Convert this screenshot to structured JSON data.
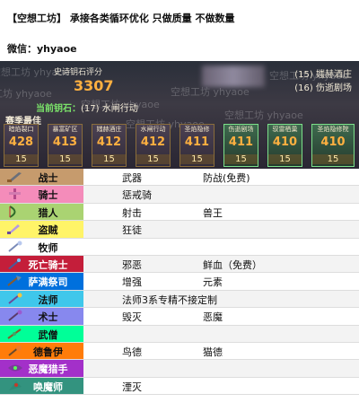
{
  "header": {
    "line1": "【空想工坊】  承接各类循环优化  只做质量  不做数量",
    "line2": "微信：yhyaoe"
  },
  "panel": {
    "score_label": "史诗钥石评分",
    "score_value": "3307",
    "side_items": [
      "(15) 媸赫酒庄",
      "(16) 伤逝剧场"
    ],
    "current_label": "当前钥石：",
    "current_value": "(17) 水闸行动",
    "season_label": "赛季最佳",
    "watermark": "空想工坊 yhyaoe",
    "dungeons": [
      {
        "name": "暗焰裂口",
        "score": "428",
        "level": "15"
      },
      {
        "name": "暴富矿区",
        "score": "413",
        "level": "15"
      },
      {
        "name": "媸赫酒庄",
        "score": "412",
        "level": "15"
      },
      {
        "name": "水闸行动",
        "score": "412",
        "level": "15"
      },
      {
        "name": "圣焰隐修",
        "score": "411",
        "level": "15"
      },
      {
        "name": "伤逝剧场",
        "score": "411",
        "level": "15"
      },
      {
        "name": "驭雷栖巢",
        "score": "410",
        "level": "15"
      },
      {
        "name": "圣焰隐修院",
        "score": "410",
        "level": "15"
      }
    ]
  },
  "classes": [
    {
      "name": "战士",
      "color": "#c69b6d",
      "icon": "warrior-icon",
      "spec1": "武器",
      "spec2": "防战(免费)"
    },
    {
      "name": "骑士",
      "color": "#f48cba",
      "icon": "paladin-icon",
      "spec1": "惩戒骑",
      "spec2": ""
    },
    {
      "name": "猎人",
      "color": "#aad372",
      "icon": "hunter-icon",
      "spec1": "射击",
      "spec2": "兽王"
    },
    {
      "name": "盗贼",
      "color": "#fff468",
      "icon": "rogue-icon",
      "spec1": "狂徒",
      "spec2": ""
    },
    {
      "name": "牧师",
      "color": "#ffffff",
      "icon": "priest-icon",
      "spec1": "",
      "spec2": ""
    },
    {
      "name": "死亡骑士",
      "color": "#c41e3a",
      "icon": "deathknight-icon",
      "spec1": "邪恶",
      "spec2": "鲜血（免费）"
    },
    {
      "name": "萨满祭司",
      "color": "#0070dd",
      "icon": "shaman-icon",
      "spec1": "增强",
      "spec2": "元素"
    },
    {
      "name": "法师",
      "color": "#3fc7eb",
      "icon": "mage-icon",
      "spec1": "法师3系专精不接定制",
      "spec2": ""
    },
    {
      "name": "术士",
      "color": "#8788ee",
      "icon": "warlock-icon",
      "spec1": "毁灭",
      "spec2": "恶魔"
    },
    {
      "name": "武僧",
      "color": "#00ff98",
      "icon": "monk-icon",
      "spec1": "",
      "spec2": ""
    },
    {
      "name": "德鲁伊",
      "color": "#ff7c0a",
      "icon": "druid-icon",
      "spec1": "鸟德",
      "spec2": "猫德"
    },
    {
      "name": "恶魔猎手",
      "color": "#a330c9",
      "icon": "demonhunter-icon",
      "spec1": "",
      "spec2": ""
    },
    {
      "name": "唤魔师",
      "color": "#33937f",
      "icon": "evoker-icon",
      "spec1": "湮灭",
      "spec2": ""
    }
  ]
}
